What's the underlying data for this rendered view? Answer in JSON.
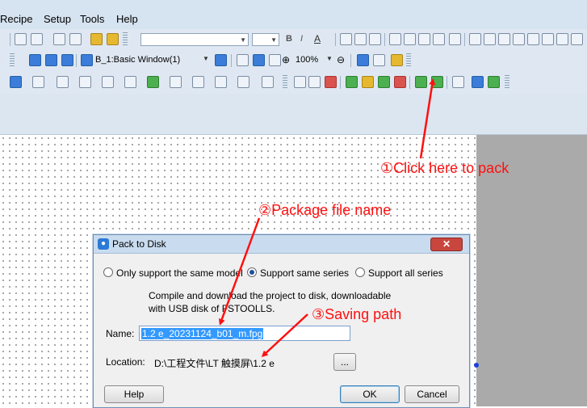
{
  "menu": [
    "Recipe",
    "Setup",
    "Tools",
    "Help"
  ],
  "toolbar": {
    "window_select": "B_1:Basic Window(1)",
    "zoom": "100%"
  },
  "annotations": {
    "pack": "①Click here to pack",
    "filename": "②Package file name",
    "path": "③Saving path"
  },
  "dialog": {
    "title": "Pack to Disk",
    "close": "✕",
    "options": [
      {
        "label": "Only support the same model",
        "selected": false
      },
      {
        "label": "Support same series",
        "selected": true
      },
      {
        "label": "Support all series",
        "selected": false
      }
    ],
    "description_line1": "Compile and download the project to disk, downloadable",
    "description_line2": "with USB disk of FSTOOLLS.",
    "name_label": "Name:",
    "name_value": "1.2 e_20231124_b01_m.fpg",
    "location_label": "Location:",
    "location_value": "D:\\工程文件\\LT 触摸屏\\1.2 e",
    "browse_label": "...",
    "help_label": "Help",
    "ok_label": "OK",
    "cancel_label": "Cancel"
  },
  "colors": {
    "annotation": "#ff1010",
    "selection": "#3399ff"
  }
}
